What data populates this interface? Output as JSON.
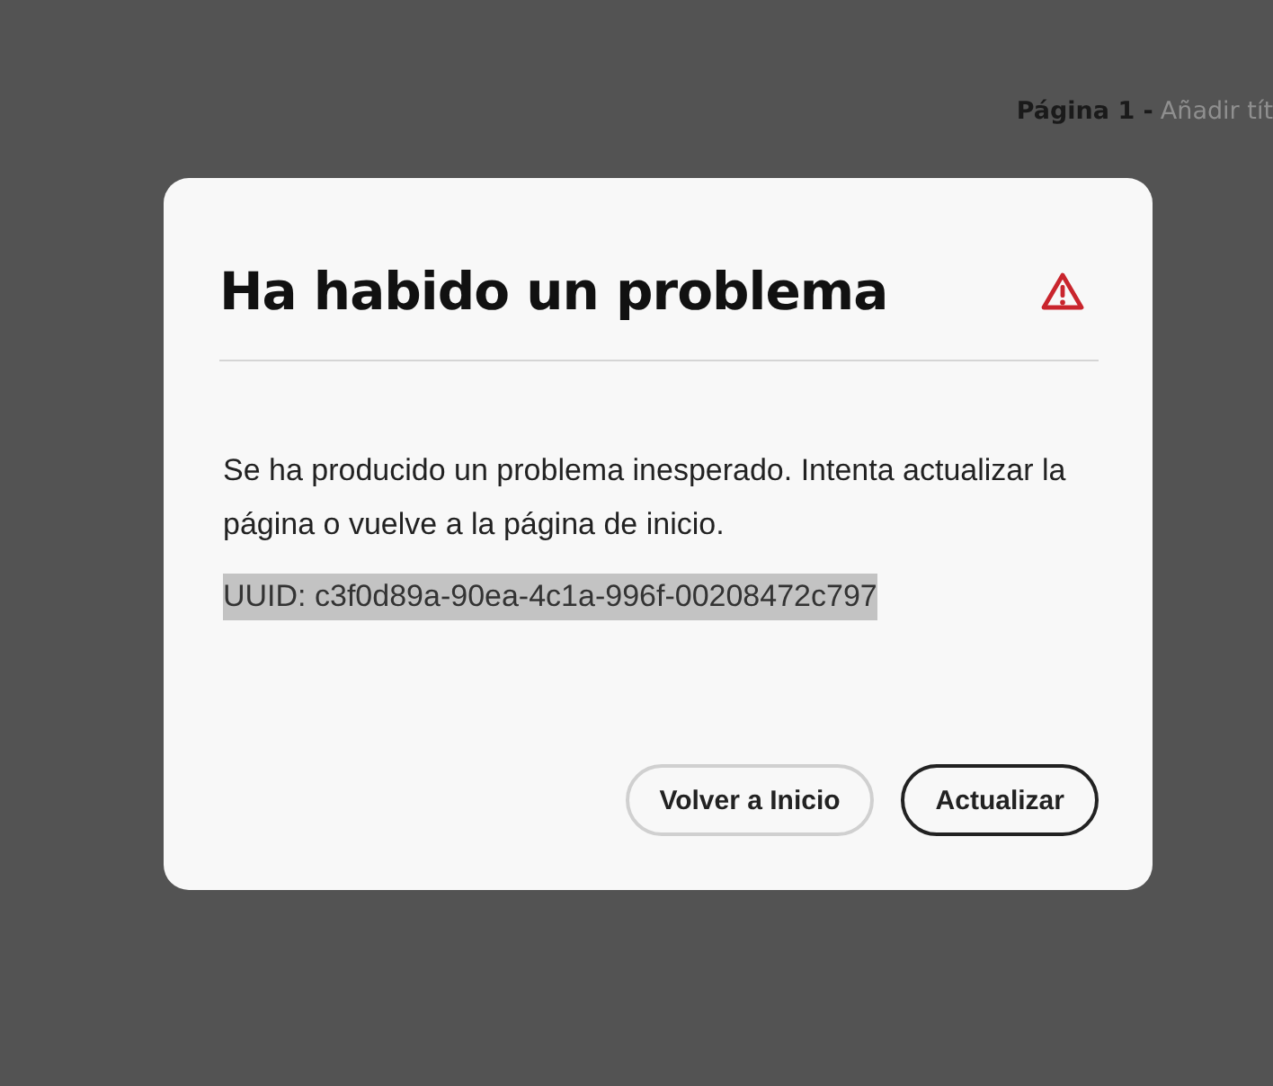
{
  "page_title": {
    "page": "Página 1 -",
    "placeholder": "Añadir tít"
  },
  "dialog": {
    "title": "Ha habido un problema",
    "message": "Se ha producido un problema inesperado. Intenta actualizar la página o vuelve a la página de inicio.",
    "uuid": {
      "text": "UUID: c3f0d89a-90ea-4c1a-996f-00208472c797",
      "highlighted": true
    },
    "buttons": [
      {
        "label": "Volver a Inicio",
        "kind": "secondary"
      },
      {
        "label": "Actualizar",
        "kind": "primary"
      }
    ]
  }
}
